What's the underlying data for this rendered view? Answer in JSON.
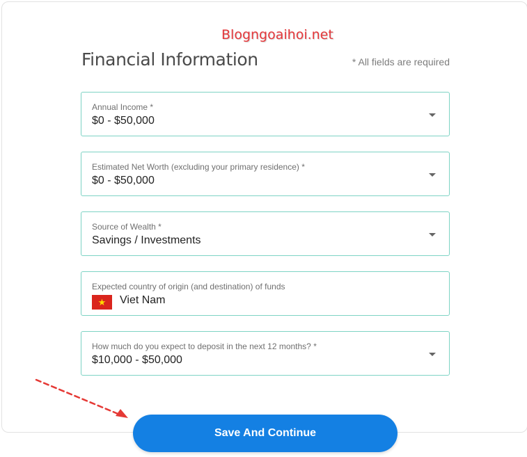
{
  "watermark": "Blogngoaihoi.net",
  "form": {
    "title": "Financial Information",
    "required_note": "* All fields are required",
    "fields": [
      {
        "label": "Annual Income *",
        "value": "$0 - $50,000"
      },
      {
        "label": "Estimated Net Worth (excluding your primary residence) *",
        "value": "$0 - $50,000"
      },
      {
        "label": "Source of Wealth *",
        "value": "Savings / Investments"
      },
      {
        "label": "Expected country of origin (and destination) of funds",
        "value": "Viet Nam"
      },
      {
        "label": "How much do you expect to deposit in the next 12 months? *",
        "value": "$10,000 - $50,000"
      }
    ],
    "save_label": "Save And Continue"
  },
  "icons": {
    "dropdown": "chevron-down-icon",
    "country_flag": "vietnam-flag-icon",
    "annotation": "red-dashed-arrow-icon"
  },
  "colors": {
    "field_border": "#7dd3c4",
    "button": "#1480e3",
    "watermark": "#e5383b",
    "arrow": "#e53935"
  }
}
